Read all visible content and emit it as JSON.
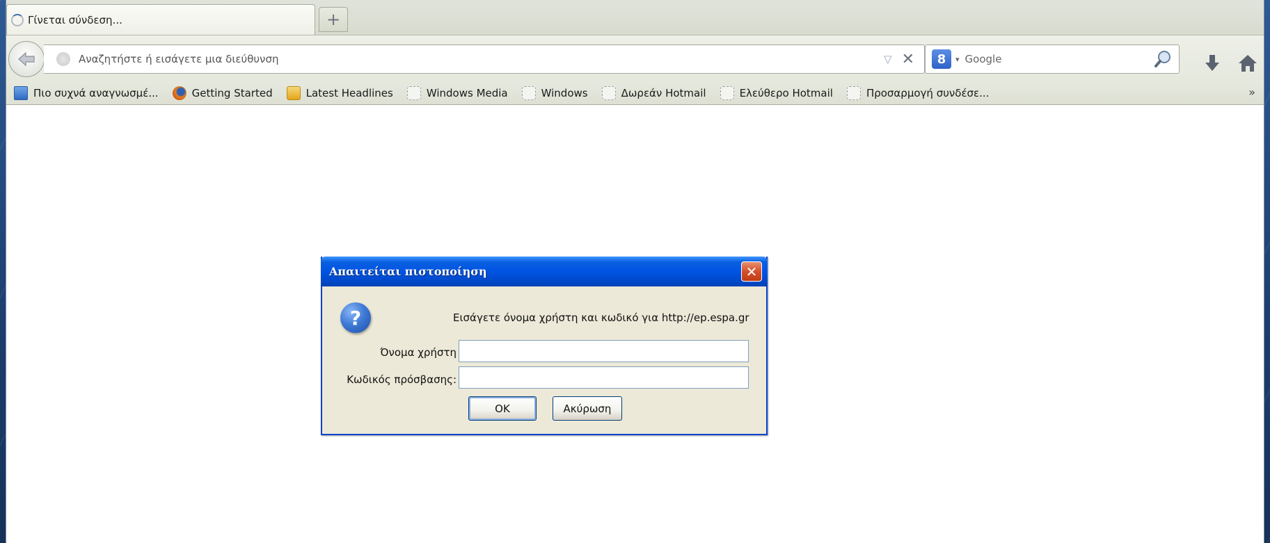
{
  "browser": {
    "tab": {
      "title": "Γίνεται σύνδεση..."
    },
    "new_tab_label": "+",
    "navbar": {
      "url_placeholder": "Αναζητήστε ή εισάγετε μια διεύθυνση",
      "dropmarker": "▽",
      "stop": "✕",
      "search_engine_letter": "8",
      "search_dropmarker": "▾",
      "search_placeholder": "Google"
    },
    "bookmarks": [
      {
        "label": "Πιο συχνά αναγνωσμέ...",
        "icon": "most-visited-icon"
      },
      {
        "label": "Getting Started",
        "icon": "firefox-icon"
      },
      {
        "label": "Latest Headlines",
        "icon": "rss-icon"
      },
      {
        "label": "Windows Media",
        "icon": "placeholder-icon"
      },
      {
        "label": "Windows",
        "icon": "placeholder-icon"
      },
      {
        "label": "Δωρεάν Hotmail",
        "icon": "placeholder-icon"
      },
      {
        "label": "Ελεύθερο Hotmail",
        "icon": "placeholder-icon"
      },
      {
        "label": "Προσαρμογή συνδέσε...",
        "icon": "placeholder-icon"
      }
    ],
    "bookmarks_overflow": "»"
  },
  "dialog": {
    "title": "Απαιτείται πιστοποίηση",
    "close": "✕",
    "prompt": "Εισάγετε όνομα χρήστη και κωδικό για http://ep.espa.gr",
    "username_label": "Όνομα χρήστη",
    "password_label": "Κωδικός πρόσβασης:",
    "username_value": "",
    "password_value": "",
    "ok_label": "OK",
    "cancel_label": "Ακύρωση"
  },
  "colors": {
    "dialog_title_bar": "#0054e3",
    "dialog_body": "#ece9d8",
    "desktop": "#1d3d6e",
    "close_button": "#d4502a"
  }
}
